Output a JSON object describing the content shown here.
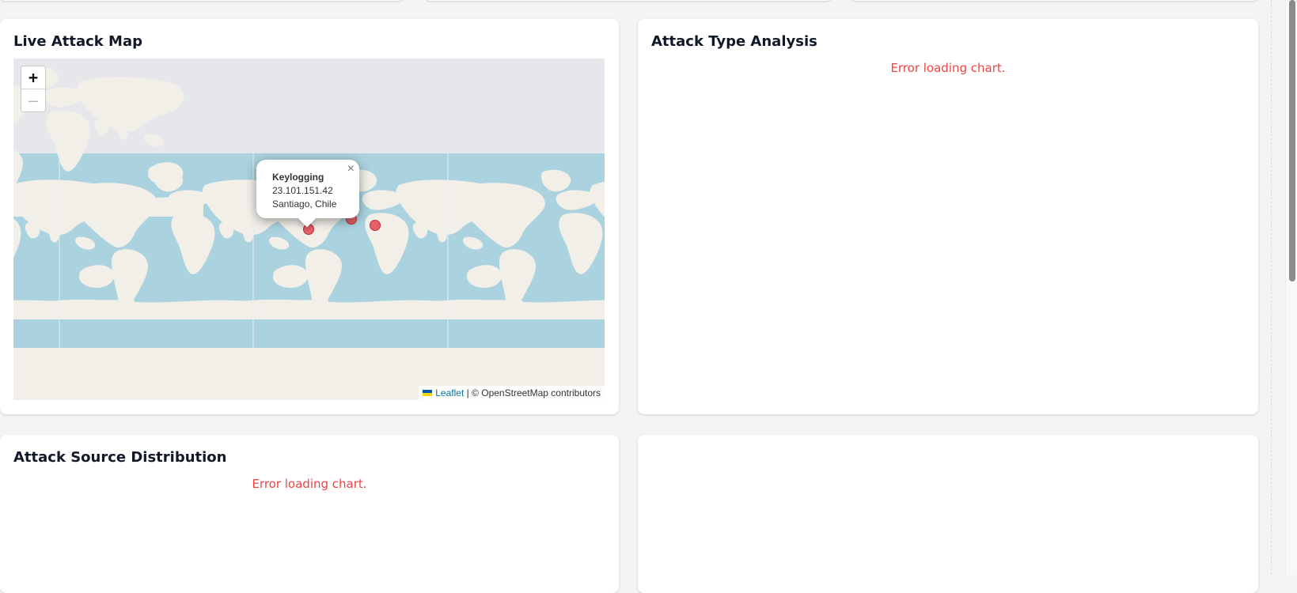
{
  "cards": {
    "live_map": {
      "title": "Live Attack Map"
    },
    "attack_type": {
      "title": "Attack Type Analysis",
      "error": "Error loading chart."
    },
    "attack_source": {
      "title": "Attack Source Distribution",
      "error": "Error loading chart."
    }
  },
  "map": {
    "zoom_in": "+",
    "zoom_out": "—",
    "attribution": {
      "leaflet": "Leaflet",
      "separator": " | ",
      "credit": "© OpenStreetMap contributors"
    },
    "popup": {
      "attack_type": "Keylogging",
      "ip": "23.101.151.42",
      "location": "Santiago, Chile",
      "close": "×"
    },
    "icons": {
      "zoom_in": "plus-icon",
      "zoom_out": "minus-icon",
      "close": "close-icon",
      "flag": "ukraine-flag-icon",
      "marker": "circle-marker-icon"
    }
  },
  "colors": {
    "error": "#ef4444",
    "marker_fill": "#e45b61",
    "marker_stroke": "#b5262d",
    "ocean": "#aad3df",
    "land": "#f2efe9",
    "map_background": "#e5e7eb",
    "link": "#0078a8"
  }
}
